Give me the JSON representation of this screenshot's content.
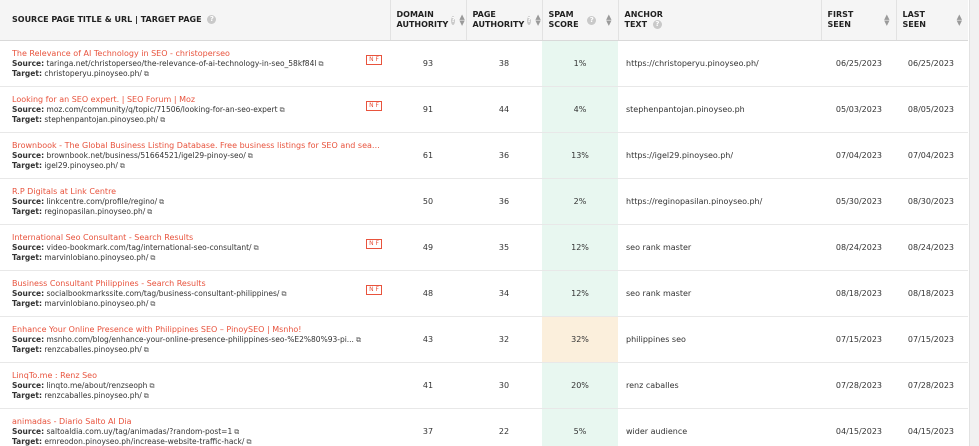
{
  "headers": {
    "source": "SOURCE PAGE TITLE & URL | TARGET PAGE",
    "domain_authority": [
      "DOMAIN",
      "AUTHORITY"
    ],
    "page_authority": [
      "PAGE",
      "AUTHORITY"
    ],
    "spam_score": [
      "SPAM",
      "SCORE"
    ],
    "anchor_text": [
      "ANCHOR",
      "TEXT"
    ],
    "first_seen": [
      "FIRST",
      "SEEN"
    ],
    "last_seen": [
      "LAST",
      "SEEN"
    ]
  },
  "labels": {
    "source": "Source:",
    "target": "Target:",
    "nofollow": "N F"
  },
  "rows": [
    {
      "title": "The Relevance of AI Technology in SEO - christoperseo",
      "source": "taringa.net/christoperseo/the-relevance-of-ai-technology-in-seo_58kf84l",
      "target": "christoperyu.pinoyseo.ph/",
      "nofollow": true,
      "da": "93",
      "pa": "38",
      "spam": "1%",
      "spam_warn": false,
      "anchor": "https://christoperyu.pinoyseo.ph/",
      "first": "06/25/2023",
      "last": "06/25/2023"
    },
    {
      "title": "Looking for an SEO expert. | SEO Forum | Moz",
      "source": "moz.com/community/q/topic/71506/looking-for-an-seo-expert",
      "target": "stephenpantojan.pinoyseo.ph/",
      "nofollow": true,
      "da": "91",
      "pa": "44",
      "spam": "4%",
      "spam_warn": false,
      "anchor": "stephenpantojan.pinoyseo.ph",
      "first": "05/03/2023",
      "last": "08/05/2023"
    },
    {
      "title": "Brownbook - The Global Business Listing Database. Free business listings for SEO and search engine ...",
      "source": "brownbook.net/business/51664521/igel29-pinoy-seo/",
      "target": "igel29.pinoyseo.ph/",
      "nofollow": false,
      "da": "61",
      "pa": "36",
      "spam": "13%",
      "spam_warn": false,
      "anchor": "https://igel29.pinoyseo.ph/",
      "first": "07/04/2023",
      "last": "07/04/2023"
    },
    {
      "title": "R.P Digitals at Link Centre",
      "source": "linkcentre.com/profile/regino/",
      "target": "reginopasilan.pinoyseo.ph/",
      "nofollow": false,
      "da": "50",
      "pa": "36",
      "spam": "2%",
      "spam_warn": false,
      "anchor": "https://reginopasilan.pinoyseo.ph/",
      "first": "05/30/2023",
      "last": "08/30/2023"
    },
    {
      "title": "International Seo Consultant - Search Results",
      "source": "video-bookmark.com/tag/international-seo-consultant/",
      "target": "marvinlobiano.pinoyseo.ph/",
      "nofollow": true,
      "da": "49",
      "pa": "35",
      "spam": "12%",
      "spam_warn": false,
      "anchor": "seo rank master",
      "first": "08/24/2023",
      "last": "08/24/2023"
    },
    {
      "title": "Business Consultant Philippines - Search Results",
      "source": "socialbookmarkssite.com/tag/business-consultant-philippines/",
      "target": "marvinlobiano.pinoyseo.ph/",
      "nofollow": true,
      "da": "48",
      "pa": "34",
      "spam": "12%",
      "spam_warn": false,
      "anchor": "seo rank master",
      "first": "08/18/2023",
      "last": "08/18/2023"
    },
    {
      "title": "Enhance Your Online Presence with Philippines SEO – PinoySEO | Msnho!",
      "source": "msnho.com/blog/enhance-your-online-presence-philippines-seo-%E2%80%93-pi...",
      "target": "renzcaballes.pinoyseo.ph/",
      "nofollow": false,
      "da": "43",
      "pa": "32",
      "spam": "32%",
      "spam_warn": true,
      "anchor": "philippines seo",
      "first": "07/15/2023",
      "last": "07/15/2023"
    },
    {
      "title": "LinqTo.me : Renz Seo",
      "source": "linqto.me/about/renzseoph",
      "target": "renzcaballes.pinoyseo.ph/",
      "nofollow": false,
      "da": "41",
      "pa": "30",
      "spam": "20%",
      "spam_warn": false,
      "anchor": "renz caballes",
      "first": "07/28/2023",
      "last": "07/28/2023"
    },
    {
      "title": "animadas - Diario Salto Al Dia",
      "source": "saltoaldia.com.uy/tag/animadas/?random-post=1",
      "target": "ernreodon.pinoyseo.ph/increase-website-traffic-hack/",
      "nofollow": false,
      "da": "37",
      "pa": "22",
      "spam": "5%",
      "spam_warn": false,
      "anchor": "wider audience",
      "first": "04/15/2023",
      "last": "04/15/2023"
    }
  ]
}
